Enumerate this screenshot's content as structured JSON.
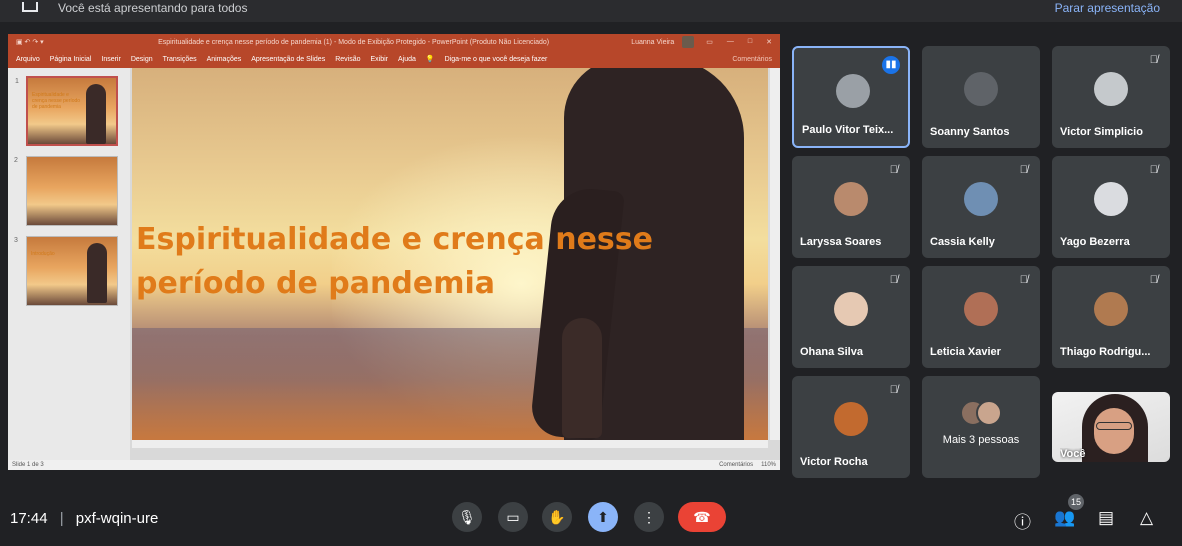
{
  "top_banner": {
    "message": "Você está apresentando para todos",
    "stop_label": "Parar apresentação"
  },
  "powerpoint": {
    "doc_title": "Espiritualidade e crença nesse período de pandemia (1) - Modo de Exibição Protegido - PowerPoint (Produto Não Licenciado)",
    "user_name": "Luanna Vieira",
    "window_controls": [
      "▭",
      "—",
      "□",
      "✕"
    ],
    "ribbon_tabs": [
      "Arquivo",
      "Página Inicial",
      "Inserir",
      "Design",
      "Transições",
      "Animações",
      "Apresentação de Slides",
      "Revisão",
      "Exibir",
      "Ajuda"
    ],
    "tell_me": "Diga-me o que você deseja fazer",
    "comments_button": "Comentários",
    "thumbnails": [
      {
        "number": "1",
        "text": "Espiritualidade e crença nesse período de pandemia"
      },
      {
        "number": "2",
        "text": ""
      },
      {
        "number": "3",
        "text": "Introdução"
      }
    ],
    "slide_title": "Espiritualidade e crença nesse período de pandemia",
    "status": {
      "slide_counter": "Slide 1 de 3",
      "comments": "Comentários",
      "zoom": "110%"
    }
  },
  "participants": [
    {
      "name": "Paulo Vitor Teix...",
      "speaking": true,
      "muted": false,
      "avatar_color": "#9aa0a6"
    },
    {
      "name": "Soanny Santos",
      "speaking": false,
      "muted": false,
      "avatar_color": "#5f6368"
    },
    {
      "name": "Victor Simplicio",
      "speaking": false,
      "muted": true,
      "avatar_color": "#c5c9cc"
    },
    {
      "name": "Laryssa Soares",
      "speaking": false,
      "muted": true,
      "avatar_color": "#b98a6d"
    },
    {
      "name": "Cassia Kelly",
      "speaking": false,
      "muted": true,
      "avatar_color": "#6f8fb3"
    },
    {
      "name": "Yago Bezerra",
      "speaking": false,
      "muted": true,
      "avatar_color": "#dadce0"
    },
    {
      "name": "Ohana Silva",
      "speaking": false,
      "muted": true,
      "avatar_color": "#e6c9b3"
    },
    {
      "name": "Leticia Xavier",
      "speaking": false,
      "muted": true,
      "avatar_color": "#b06f56"
    },
    {
      "name": "Thiago Rodrigu...",
      "speaking": false,
      "muted": true,
      "avatar_color": "#b07a50"
    },
    {
      "name": "Victor Rocha",
      "speaking": false,
      "muted": true,
      "avatar_color": "#c26a2f"
    },
    {
      "name": "Mais 3 pessoas",
      "speaking": false,
      "muted": false,
      "avatar_color": "#8a6f60"
    },
    {
      "name": "Você",
      "speaking": false,
      "muted": false,
      "avatar_color": "#d8a083"
    }
  ],
  "bottom_bar": {
    "time": "17:44",
    "separator": "|",
    "meeting_code": "pxf-wqin-ure",
    "people_count": "15"
  },
  "colors": {
    "accent": "#8ab4f8",
    "hangup": "#ea4335",
    "ppt_brand": "#b7472a",
    "slide_title": "#e07b1a"
  }
}
